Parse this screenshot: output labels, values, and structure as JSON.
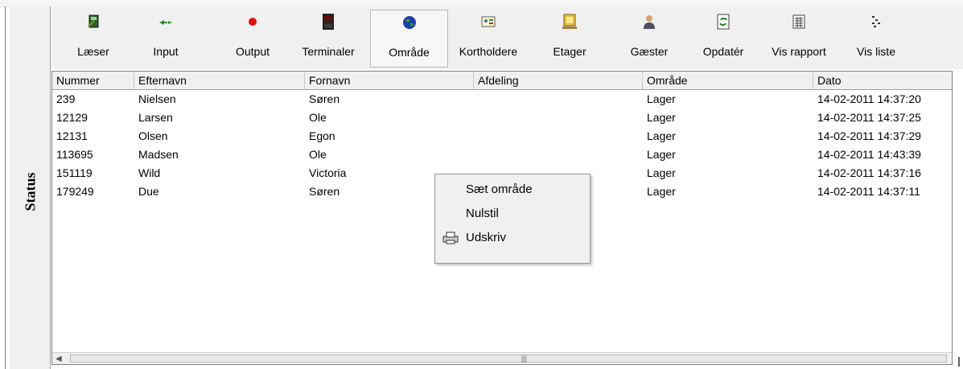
{
  "status_panel": {
    "label": "Status"
  },
  "toolbar": {
    "items": [
      {
        "label": "Læser",
        "icon": "card-reader-icon"
      },
      {
        "label": "Input",
        "icon": "input-arrow-icon"
      },
      {
        "label": "Output",
        "icon": "red-dot-icon"
      },
      {
        "label": "Terminaler",
        "icon": "terminal-icon"
      },
      {
        "label": "Område",
        "icon": "globe-icon",
        "active": true
      },
      {
        "label": "Kortholdere",
        "icon": "id-card-icon"
      },
      {
        "label": "Etager",
        "icon": "floor-icon"
      },
      {
        "label": "Gæster",
        "icon": "guest-icon"
      },
      {
        "label": "Opdatér",
        "icon": "refresh-icon"
      },
      {
        "label": "Vis rapport",
        "icon": "report-icon"
      },
      {
        "label": "Vis liste",
        "icon": "list-icon"
      }
    ]
  },
  "table": {
    "columns": [
      "Nummer",
      "Efternavn",
      "Fornavn",
      "Afdeling",
      "Område",
      "Dato"
    ],
    "rows": [
      [
        "239",
        "Nielsen",
        "Søren",
        "",
        "Lager",
        "14-02-2011 14:37:20"
      ],
      [
        "12129",
        "Larsen",
        "Ole",
        "",
        "Lager",
        "14-02-2011 14:37:25"
      ],
      [
        "12131",
        "Olsen",
        "Egon",
        "",
        "Lager",
        "14-02-2011 14:37:29"
      ],
      [
        "113695",
        "Madsen",
        "Ole",
        "",
        "Lager",
        "14-02-2011 14:43:39"
      ],
      [
        "151119",
        "Wild",
        "Victoria",
        "",
        "Lager",
        "14-02-2011 14:37:16"
      ],
      [
        "179249",
        "Due",
        "Søren",
        "",
        "Lager",
        "14-02-2011 14:37:11"
      ]
    ]
  },
  "context_menu": {
    "items": [
      {
        "label": "Sæt område",
        "icon": ""
      },
      {
        "label": "Nulstil",
        "icon": ""
      },
      {
        "label": "Udskriv",
        "icon": "printer-icon"
      }
    ]
  },
  "colors": {
    "panel_bg": "#f0f0f0",
    "grid_header_bg": "#f0f0f0",
    "border": "#808080"
  }
}
